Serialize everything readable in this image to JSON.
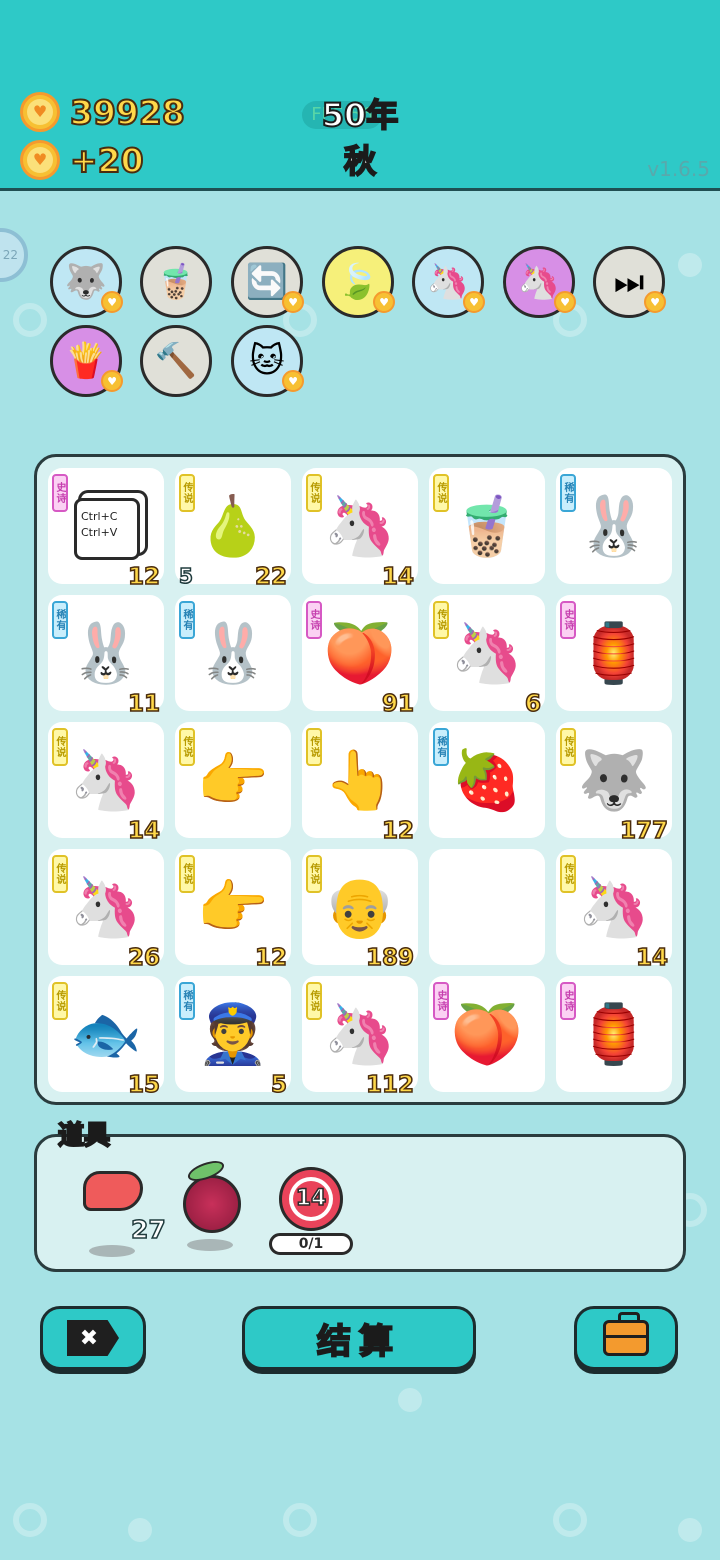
{
  "header": {
    "coins": "39928",
    "income": "+20",
    "fps": "FPS:56",
    "year": "50年",
    "season": "秋",
    "version": "v1.6.5"
  },
  "side_tab": {
    "label": "22"
  },
  "abilities": [
    {
      "name": "husky-skill",
      "icon": "🐺",
      "bg": "#bfe7f4"
    },
    {
      "name": "milk-tea-skill",
      "icon": "🧋",
      "bg": "#e0e0d8"
    },
    {
      "name": "refresh-skill",
      "icon": "🔄",
      "bg": "#e0e0d8"
    },
    {
      "name": "leaf-skill",
      "icon": "🍃",
      "bg": "#f6f07a"
    },
    {
      "name": "twin-unicorns-skill",
      "icon": "🦄",
      "bg": "#bfe7f4"
    },
    {
      "name": "twin-unicorns-epic-skill",
      "icon": "🦄",
      "bg": "#d78fe6"
    },
    {
      "name": "skip-skill",
      "icon": "⏭",
      "bg": "#e0e0d8"
    },
    {
      "name": "fries-skill",
      "icon": "🍟",
      "bg": "#d78fe6"
    },
    {
      "name": "hammer-skill",
      "icon": "🔨",
      "bg": "#e0e0d8"
    },
    {
      "name": "cat-skill",
      "icon": "🐱",
      "bg": "#bfe7f4"
    }
  ],
  "rarity_labels": {
    "legend": "传说",
    "epic": "史诗",
    "rare": "稀有"
  },
  "board": [
    {
      "item": "copy-paste-card",
      "icon": "📋",
      "rarity": "epic",
      "count": "12",
      "extra": "Ctrl+C Ctrl+V"
    },
    {
      "item": "pomelo",
      "icon": "🍐",
      "rarity": "legend",
      "count": "22",
      "left": "5"
    },
    {
      "item": "unicorn",
      "icon": "🦄",
      "rarity": "legend",
      "count": "14"
    },
    {
      "item": "milk-tea",
      "icon": "🧋",
      "rarity": "legend",
      "count": ""
    },
    {
      "item": "rabbit",
      "icon": "🐰",
      "rarity": "rare",
      "count": ""
    },
    {
      "item": "rabbit",
      "icon": "🐰",
      "rarity": "rare",
      "count": "11"
    },
    {
      "item": "rabbit",
      "icon": "🐰",
      "rarity": "rare",
      "count": ""
    },
    {
      "item": "peach",
      "icon": "🍑",
      "rarity": "epic",
      "count": "91"
    },
    {
      "item": "unicorn",
      "icon": "🦄",
      "rarity": "legend",
      "count": "6"
    },
    {
      "item": "rabbit-house",
      "icon": "🏮",
      "rarity": "epic",
      "count": ""
    },
    {
      "item": "unicorn",
      "icon": "🦄",
      "rarity": "legend",
      "count": "14"
    },
    {
      "item": "pointing-hand",
      "icon": "👉",
      "rarity": "legend",
      "count": ""
    },
    {
      "item": "finger-up",
      "icon": "👆",
      "rarity": "legend",
      "count": "12"
    },
    {
      "item": "lychee",
      "icon": "🍓",
      "rarity": "rare",
      "count": ""
    },
    {
      "item": "husky-king",
      "icon": "🐺",
      "rarity": "legend",
      "count": "177"
    },
    {
      "item": "unicorn",
      "icon": "🦄",
      "rarity": "legend",
      "count": "26"
    },
    {
      "item": "pointing-hand",
      "icon": "👉",
      "rarity": "legend",
      "count": "12"
    },
    {
      "item": "old-man",
      "icon": "👴",
      "rarity": "legend",
      "count": "189"
    },
    {
      "item": "empty",
      "icon": "",
      "rarity": "",
      "count": ""
    },
    {
      "item": "unicorn",
      "icon": "🦄",
      "rarity": "legend",
      "count": "14"
    },
    {
      "item": "koi-fish",
      "icon": "🐟",
      "rarity": "legend",
      "count": "15"
    },
    {
      "item": "police",
      "icon": "👮",
      "rarity": "rare",
      "count": "5"
    },
    {
      "item": "unicorn",
      "icon": "🦄",
      "rarity": "legend",
      "count": "112"
    },
    {
      "item": "peach",
      "icon": "🍑",
      "rarity": "epic",
      "count": ""
    },
    {
      "item": "rabbit-house",
      "icon": "🏮",
      "rarity": "epic",
      "count": ""
    }
  ],
  "items_panel": {
    "title": "道具",
    "items": [
      {
        "name": "liver-item",
        "icon": "🫀",
        "count": "27"
      },
      {
        "name": "bayberry-item",
        "icon": "🍓",
        "count": ""
      },
      {
        "name": "timer-item",
        "icon": "14",
        "progress": "0/1"
      }
    ]
  },
  "buttons": {
    "close_icon": "✖",
    "settle_label": "结算",
    "bag_icon": "💼"
  }
}
